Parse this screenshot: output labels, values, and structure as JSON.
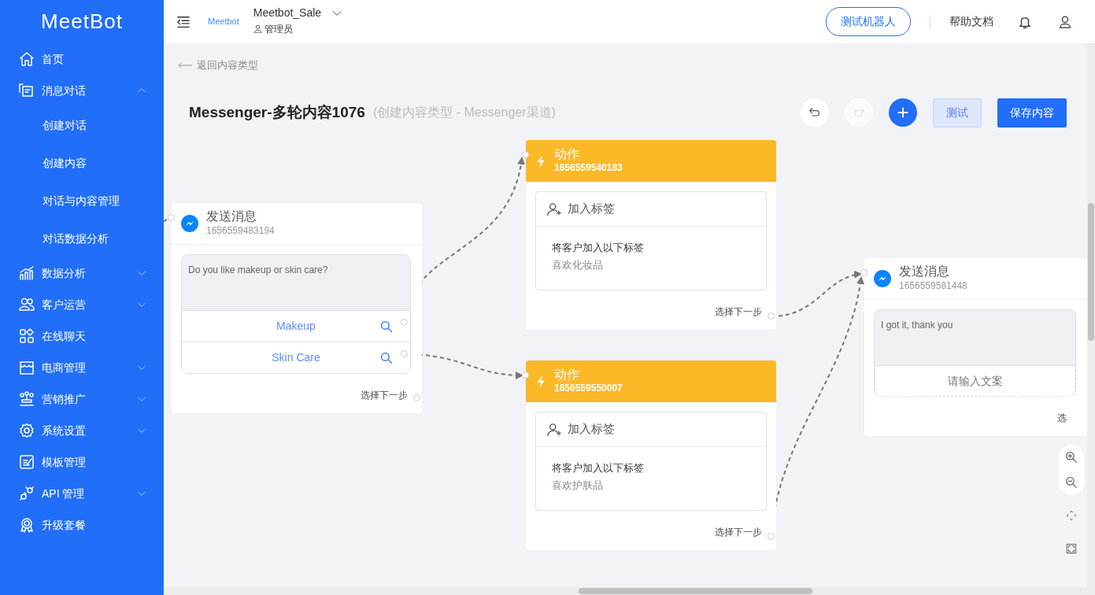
{
  "sidebar": {
    "logo": "MeetBot",
    "items": [
      {
        "label": "首页"
      },
      {
        "label": "消息对话",
        "expanded": true,
        "children": [
          {
            "label": "创建对话"
          },
          {
            "label": "创建内容"
          },
          {
            "label": "对话与内容管理"
          },
          {
            "label": "对话数据分析"
          }
        ]
      },
      {
        "label": "数据分析",
        "expanded": false
      },
      {
        "label": "客户运营",
        "expanded": false
      },
      {
        "label": "在线聊天"
      },
      {
        "label": "电商管理",
        "expanded": false
      },
      {
        "label": "营销推广",
        "expanded": false
      },
      {
        "label": "系统设置",
        "expanded": false
      },
      {
        "label": "模板管理"
      },
      {
        "label": "API 管理",
        "expanded": false
      },
      {
        "label": "升级套餐"
      }
    ]
  },
  "header": {
    "brand": "Meetbot",
    "account": "Meetbot_Sale",
    "role": "管理员",
    "test_bot_button": "测试机器人",
    "help_link": "帮助文档"
  },
  "back_link": "返回内容类型",
  "title": "Messenger-多轮内容1076",
  "subtitle": "(创建内容类型 - Messenger渠道)",
  "toolbar": {
    "undo_disabled": false,
    "redo_disabled": true,
    "test_button": "测试",
    "save_button": "保存内容"
  },
  "nodes": [
    {
      "kind": "message",
      "title": "发送消息",
      "id": "1656559483194",
      "text": "Do you like makeup or skin care?",
      "buttons": [
        {
          "label": "Makeup"
        },
        {
          "label": "Skin Care"
        }
      ],
      "footer": "选择下一步"
    },
    {
      "kind": "action",
      "title": "动作",
      "id": "1656559540183",
      "action": "加入标签",
      "description": "将客户加入以下标签",
      "tag": "喜欢化妆品",
      "footer": "选择下一步"
    },
    {
      "kind": "action",
      "title": "动作",
      "id": "1656559550007",
      "action": "加入标签",
      "description": "将客户加入以下标签",
      "tag": "喜欢护肤品",
      "footer": "选择下一步"
    },
    {
      "kind": "message",
      "title": "发送消息",
      "id": "1656559581448",
      "text": "I got it, thank you",
      "placeholder": "请输入文案",
      "footer": "选"
    }
  ]
}
